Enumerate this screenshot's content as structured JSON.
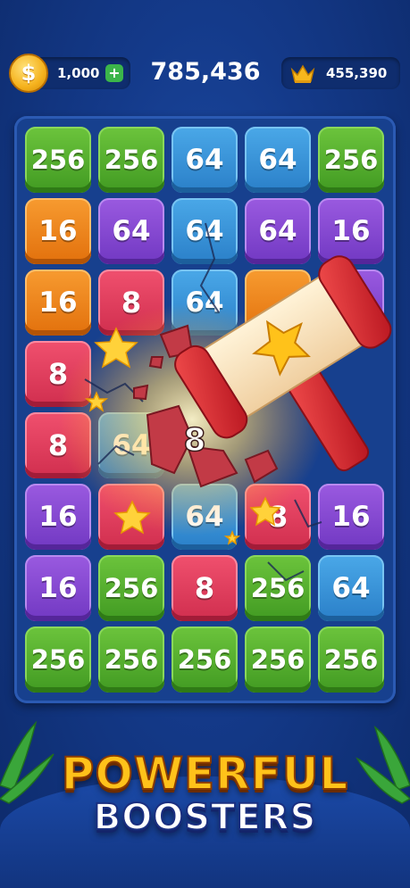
{
  "hud": {
    "coins": "1,000",
    "coin_symbol": "$",
    "plus_label": "+",
    "score": "785,436",
    "best": "455,390"
  },
  "board": {
    "rows": [
      [
        "256",
        "256",
        "64",
        "64",
        "256"
      ],
      [
        "16",
        "64",
        "64",
        "64",
        "16"
      ],
      [
        "16",
        "8",
        "64",
        "",
        ""
      ],
      [
        "8",
        "",
        "",
        "",
        ""
      ],
      [
        "8",
        "64",
        "8",
        "",
        ""
      ],
      [
        "16",
        "",
        "64",
        "8",
        "16"
      ],
      [
        "16",
        "256",
        "8",
        "256",
        "64"
      ],
      [
        "256",
        "256",
        "256",
        "256",
        "256"
      ]
    ],
    "colors": [
      [
        "green",
        "green",
        "blue",
        "blue",
        "green"
      ],
      [
        "orange",
        "purple",
        "blue",
        "purple",
        "purple"
      ],
      [
        "orange",
        "pink",
        "blue",
        "orange",
        "purple"
      ],
      [
        "pink",
        "",
        "",
        "",
        ""
      ],
      [
        "pink",
        "blue",
        "",
        "",
        ""
      ],
      [
        "purple",
        "pink",
        "blue",
        "pink",
        "purple"
      ],
      [
        "purple",
        "green",
        "pink",
        "green",
        "blue"
      ],
      [
        "green",
        "green",
        "green",
        "green",
        "green"
      ]
    ]
  },
  "booster": {
    "name": "hammer",
    "smashed_tile": "8"
  },
  "tagline": {
    "line1": "POWERFUL",
    "line2": "BOOSTERS"
  },
  "palette": {
    "green": "#4caf2a",
    "blue": "#3592d8",
    "orange": "#ee8420",
    "purple": "#8347d2",
    "pink": "#e03e5e",
    "background": "#143a8a"
  }
}
